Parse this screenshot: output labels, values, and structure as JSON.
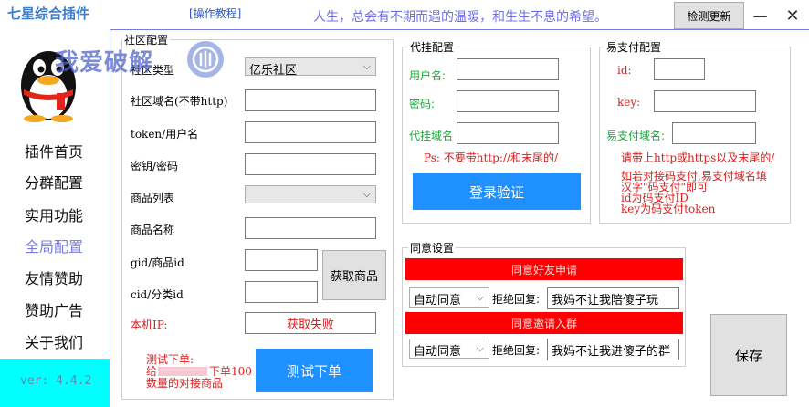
{
  "header": {
    "app_title": "七星综合插件",
    "tutorial_link": "[操作教程]",
    "slogan": "人生，总会有不期而遇的温暖，和生生不息的希望。",
    "check_update": "检测更新",
    "minimize": "—",
    "close": "✕"
  },
  "sidebar": {
    "items": [
      {
        "label": "插件首页"
      },
      {
        "label": "分群配置"
      },
      {
        "label": "实用功能"
      },
      {
        "label": "全局配置"
      },
      {
        "label": "友情赞助"
      },
      {
        "label": "赞助广告"
      },
      {
        "label": "关于我们"
      }
    ],
    "version": "ver: 4.4.2"
  },
  "watermark": {
    "text": "我爱破解",
    "badge_icon": "lock-icon"
  },
  "community": {
    "title": "社区配置",
    "type_label": "社区类型",
    "type_value": "亿乐社区",
    "domain_label": "社区域名(不带http)",
    "domain_value": "",
    "token_label": "token/用户名",
    "token_value": "",
    "secret_label": "密钥/密码",
    "secret_value": "",
    "goods_list_label": "商品列表",
    "goods_list_value": "",
    "goods_name_label": "商品名称",
    "goods_name_value": "",
    "gid_label": "gid/商品id",
    "gid_value": "",
    "cid_label": "cid/分类id",
    "cid_value": "",
    "get_goods_button": "获取商品",
    "local_ip_label": "本机IP:",
    "local_ip_value": "获取失败",
    "test_order_note_line1": "测试下单:",
    "test_order_note_line2a": "给",
    "test_order_note_line2b": "下单100",
    "test_order_note_line3": "数量的对接商品",
    "test_order_button": "测试下单"
  },
  "proxy": {
    "title": "代挂配置",
    "username_label": "用户名:",
    "username_value": "",
    "password_label": "密码:",
    "password_value": "",
    "domain_label": "代挂域名",
    "domain_value": "",
    "note": "Ps: 不要带http://和末尾的/",
    "login_button": "登录验证"
  },
  "epay": {
    "title": "易支付配置",
    "id_label": "id:",
    "id_value": "",
    "key_label": "key:",
    "key_value": "",
    "domain_label": "易支付域名:",
    "domain_value": "",
    "note1": "请带上http或https以及末尾的/",
    "note2": "如若对接码支付,易支付域名填",
    "note3": "汉字\"码支付\"即可",
    "note4": "id为码支付ID",
    "note5": "key为码支付token"
  },
  "agree": {
    "title": "同意设置",
    "friend_request_button": "同意好友申请",
    "friend_mode": "自动同意",
    "friend_reject_label": "拒绝回复:",
    "friend_reject_value": "我妈不让我陪傻子玩",
    "group_invite_button": "同意邀请入群",
    "group_mode": "自动同意",
    "group_reject_label": "拒绝回复:",
    "group_reject_value": "我妈不让我进傻子的群"
  },
  "save_button": "保存",
  "colors": {
    "accent_blue": "#1e90ff",
    "alert_red": "#ff0000",
    "version_bg": "#00ffff",
    "label_green": "#1aa83a"
  }
}
